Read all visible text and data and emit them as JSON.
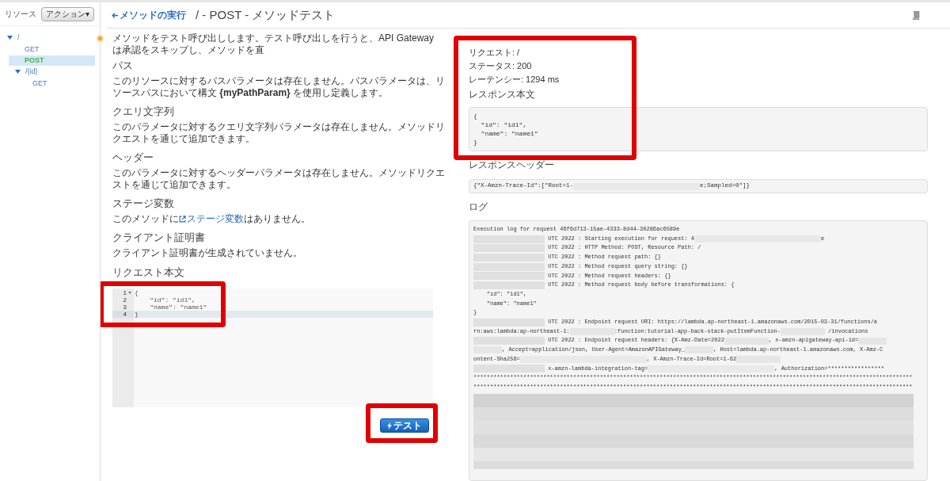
{
  "sidebar": {
    "title": "リソース",
    "action_button": "アクション▾",
    "tree": [
      {
        "label": "/",
        "kind": "resource",
        "expanded": true,
        "selected": false,
        "children": [
          {
            "label": "GET",
            "kind": "method",
            "selected": false
          },
          {
            "label": "POST",
            "kind": "method",
            "selected": true
          },
          {
            "label": "/{id}",
            "kind": "resource",
            "expanded": true,
            "selected": false,
            "children": [
              {
                "label": "GET",
                "kind": "method",
                "selected": false
              }
            ]
          }
        ]
      }
    ]
  },
  "header": {
    "back_link": "メソッドの実行",
    "title": "/ - POST - メソッドテスト"
  },
  "intro": "メソッドをテスト呼び出しします。テスト呼び出しを行うと、API Gateway は承認をスキップし、メソッドを直",
  "sections": [
    {
      "kind": "text",
      "heading": "パス",
      "body": "このリソースに対するパスパラメータは存在しません。パスパラメータは、リソースパスにおいて構文 **{myPathParam}** を使用し定義します。"
    },
    {
      "kind": "text",
      "heading": "クエリ文字列",
      "body": "このパラメータに対するクエリ文字列パラメータは存在しません。メソッドリクエストを通じて追加できます。"
    },
    {
      "kind": "text",
      "heading": "ヘッダー",
      "body": "このパラメータに対するヘッダーパラメータは存在しません。メソッドリクエストを通じて追加できます。"
    },
    {
      "kind": "link",
      "heading": "ステージ変数",
      "before": "このメソッドに",
      "link": "ステージ変数",
      "after": "はありません。"
    },
    {
      "kind": "text",
      "heading": "クライアント証明書",
      "body": "クライアント証明書が生成されていません。"
    }
  ],
  "request_body": {
    "heading": "リクエスト本文",
    "highlighted": true,
    "lines": [
      {
        "number": "1",
        "text": "{",
        "foldable": true,
        "active": false
      },
      {
        "number": "2",
        "text": "    \"id\": \"id1\",",
        "foldable": false,
        "active": false
      },
      {
        "number": "3",
        "text": "    \"name\": \"name1\"",
        "foldable": false,
        "active": false
      },
      {
        "number": "4",
        "text": "}",
        "foldable": false,
        "active": true
      }
    ]
  },
  "test_button": {
    "label": "テスト",
    "highlighted": true
  },
  "response": {
    "highlighted": true,
    "request": "リクエスト: /",
    "status": "ステータス: 200",
    "latency": "レーテンシー: 1294 ms",
    "body_heading": "レスポンス本文",
    "body": [
      "{",
      "  \"id\": \"id1\",",
      "  \"name\": \"name1\"",
      "}"
    ],
    "headers_heading": "レスポンスヘッダー",
    "headers": [
      {
        "kind": "text",
        "text": "{\"X-Amzn-Trace-Id\":[\"Root=1-"
      },
      {
        "kind": "mask-long"
      },
      {
        "kind": "text",
        "text": "e;Sampled=0\"]}"
      }
    ],
    "log_heading": "ログ",
    "log": [
      [
        {
          "kind": "text",
          "text": "Execution log for request 46f6d713-15ae-4333-8d44-30286ac6589e"
        }
      ],
      [
        {
          "kind": "stamp"
        },
        {
          "kind": "text",
          "text": " UTC 2022 : Starting execution for request: 4"
        },
        {
          "kind": "mask-long"
        },
        {
          "kind": "text",
          "text": "e"
        }
      ],
      [
        {
          "kind": "stamp"
        },
        {
          "kind": "text",
          "text": " UTC 2022 : HTTP Method: POST, Resource Path: /"
        }
      ],
      [
        {
          "kind": "stamp"
        },
        {
          "kind": "text",
          "text": " UTC 2022 : Method request path: {}"
        }
      ],
      [
        {
          "kind": "stamp"
        },
        {
          "kind": "text",
          "text": " UTC 2022 : Method request query string: {}"
        }
      ],
      [
        {
          "kind": "stamp"
        },
        {
          "kind": "text",
          "text": " UTC 2022 : Method request headers: {}"
        }
      ],
      [
        {
          "kind": "stamp"
        },
        {
          "kind": "text",
          "text": " UTC 2022 : Method request body before transformations: {"
        }
      ],
      [
        {
          "kind": "text",
          "text": "    \"id\": \"id1\","
        }
      ],
      [
        {
          "kind": "text",
          "text": "    \"name\": \"name1\""
        }
      ],
      [
        {
          "kind": "text",
          "text": "}"
        }
      ],
      [
        {
          "kind": "stamp"
        },
        {
          "kind": "text",
          "text": " UTC 2022 : Endpoint request URI: https://lambda.ap-northeast-1.amazonaws.com/2015-03-31/functions/a"
        }
      ],
      [
        {
          "kind": "text",
          "text": "rn:aws:lambda:ap-northeast-1:"
        },
        {
          "kind": "mask-medium"
        },
        {
          "kind": "text",
          "text": ":function:tutorial-app-back-stack-putItemFunction-"
        },
        {
          "kind": "mask-medium"
        },
        {
          "kind": "text",
          "text": " /invocations"
        }
      ],
      [
        {
          "kind": "stamp"
        },
        {
          "kind": "text",
          "text": " UTC 2022 : Endpoint request headers: {X-Amz-Date=2022"
        },
        {
          "kind": "mask-medium"
        },
        {
          "kind": "text",
          "text": ", x-amzn-apigateway-api-id="
        },
        {
          "kind": "mask-short"
        }
      ],
      [
        {
          "kind": "mask-short"
        },
        {
          "kind": "text",
          "text": ", Accept=application/json, User-Agent=AmazonAPIGateway_"
        },
        {
          "kind": "mask-short"
        },
        {
          "kind": "text",
          "text": ", Host=lambda.ap-northeast-1.amazonaws.com, X-Amz-C"
        }
      ],
      [
        {
          "kind": "text",
          "text": "ontent-Sha256="
        },
        {
          "kind": "mask-long"
        },
        {
          "kind": "text",
          "text": ", X-Amzn-Trace-Id=Root=1-62"
        },
        {
          "kind": "mask-medium"
        }
      ],
      [
        {
          "kind": "stamp"
        },
        {
          "kind": "text",
          "text": " x-amzn-lambda-integration-tag="
        },
        {
          "kind": "mask-long"
        },
        {
          "kind": "text",
          "text": ", Authorization=*****************"
        }
      ],
      [
        {
          "kind": "text",
          "text": "************************************************************************************************************************************"
        }
      ],
      [
        {
          "kind": "text",
          "text": "************************************************************************************************************************************"
        }
      ],
      [
        {
          "kind": "mask-block"
        }
      ]
    ]
  }
}
